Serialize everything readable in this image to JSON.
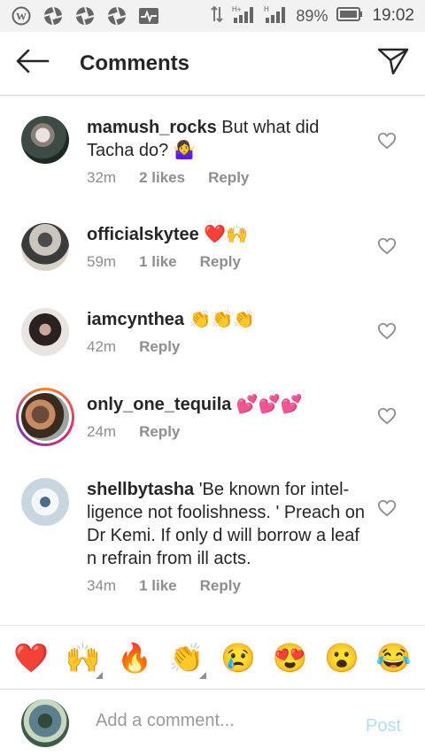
{
  "status_bar": {
    "battery": "89%",
    "time": "19:02",
    "icons": [
      "wordpress-icon",
      "aperture-icon",
      "aperture-icon",
      "aperture-icon",
      "activity-icon"
    ]
  },
  "header": {
    "title": "Comments",
    "back_icon": "arrow-left-icon",
    "send_icon": "paper-plane-icon"
  },
  "comments": [
    {
      "user": "mamush_rocks",
      "text": " But what did Tacha do? 🤷‍♀️",
      "time": "32m",
      "likes": "2 likes",
      "reply": "Reply"
    },
    {
      "user": "officialskytee",
      "text": " ❤️🙌",
      "time": "59m",
      "likes": "1 like",
      "reply": "Reply"
    },
    {
      "user": "iamcynthea",
      "text": " 👏👏👏",
      "time": "42m",
      "likes": "",
      "reply": "Reply"
    },
    {
      "user": "only_one_tequila",
      "text": " 💕💕💕",
      "time": "24m",
      "likes": "",
      "reply": "Reply"
    },
    {
      "user": "shellbytasha",
      "text": " 'Be known for intel-ligence not foolishness. ' Preach on Dr Kemi. If only d will borrow a leaf n refrain from ill acts.",
      "time": "34m",
      "likes": "1 like",
      "reply": "Reply"
    }
  ],
  "emoji_bar": [
    "❤️",
    "🙌",
    "🔥",
    "👏",
    "😢",
    "😍",
    "😮",
    "😂"
  ],
  "composer": {
    "placeholder": "Add a comment...",
    "post_label": "Post"
  },
  "colors": {
    "post_disabled": "#b3dbff",
    "meta_gray": "#8e8e8e"
  }
}
